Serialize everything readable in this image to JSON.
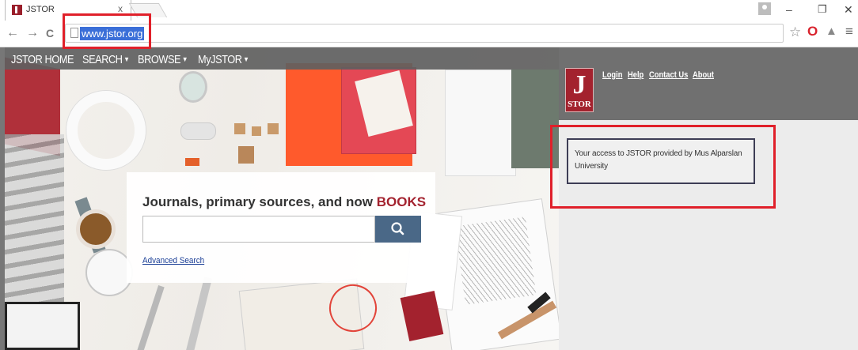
{
  "browser": {
    "tab_title": "JSTOR",
    "tab_close": "x",
    "url": "www.jstor.org",
    "window_minimize": "–",
    "window_maximize": "❐",
    "window_close": "✕",
    "back_glyph": "←",
    "forward_glyph": "→",
    "reload_glyph": "C",
    "star_glyph": "☆",
    "opera_glyph": "O",
    "extension_glyph": "▲",
    "menu_glyph": "≡",
    "icons": [
      "tab-favicon",
      "profile-icon",
      "back-arrow-icon",
      "forward-arrow-icon",
      "reload-icon",
      "page-icon",
      "bookmark-star-icon",
      "opera-icon",
      "extension-icon",
      "menu-icon"
    ]
  },
  "nav": {
    "items": [
      {
        "label": "JSTOR HOME",
        "dropdown": false
      },
      {
        "label": "SEARCH",
        "dropdown": true
      },
      {
        "label": "BROWSE",
        "dropdown": true
      },
      {
        "label": "MyJSTOR",
        "dropdown": true
      }
    ],
    "caret": "▼"
  },
  "header": {
    "logo_letter": "J",
    "logo_word": "STOR",
    "links": [
      "Login",
      "Help",
      "Contact Us",
      "About"
    ]
  },
  "access": {
    "text": "Your access to JSTOR provided by Mus Alparslan University"
  },
  "search": {
    "heading": "Journals, primary sources, and now",
    "heading_accent": "BOOKS",
    "input_value": "",
    "advanced_label": "Advanced Search"
  },
  "colors": {
    "brand": "#a3222e",
    "search_button": "#4a6887",
    "highlight": "#e0202a",
    "nav_bar": "#5f5f5f"
  }
}
